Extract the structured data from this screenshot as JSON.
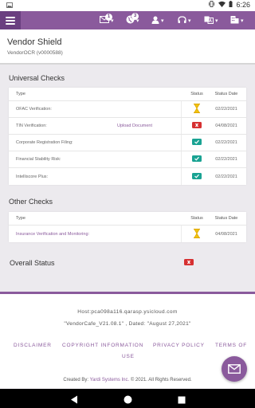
{
  "status_bar": {
    "time": "6:26"
  },
  "nav": {
    "messages_badge": "1",
    "notifications_badge": "3"
  },
  "header": {
    "title": "Vendor Shield",
    "subtitle": "VendorOCR (v0000588)"
  },
  "universal": {
    "title": "Universal Checks",
    "columns": {
      "type": "Type",
      "status": "Status",
      "date": "Status Date"
    },
    "rows": [
      {
        "type": "OFAC Verification:",
        "link": "",
        "status": "pending",
        "date": "02/22/2021"
      },
      {
        "type": "TIN Verification:",
        "link": "Upload Document",
        "status": "fail",
        "date": "04/08/2021"
      },
      {
        "type": "Corporate Registration Filing:",
        "link": "",
        "status": "ok",
        "date": "02/22/2021"
      },
      {
        "type": "Financial Stability Risk:",
        "link": "",
        "status": "ok",
        "date": "02/22/2021"
      },
      {
        "type": "Intelliscore Plus:",
        "link": "",
        "status": "ok",
        "date": "02/22/2021"
      }
    ]
  },
  "other": {
    "title": "Other Checks",
    "columns": {
      "type": "Type",
      "status": "Status",
      "date": "Status Date"
    },
    "rows": [
      {
        "type": "Insurance Verification and Monitoring:",
        "status": "pending",
        "date": "04/08/2021"
      }
    ]
  },
  "overall": {
    "label": "Overall Status",
    "status": "fail"
  },
  "footer": {
    "host": "Host:pca098a116.qarasp.ysicloud.com",
    "version": "\"VendorCafe_V21.08.1\" , Dated: \"August 27,2021\"",
    "links": {
      "disclaimer": "DISCLAIMER",
      "copyright_info": "COPYRIGHT INFORMATION",
      "privacy": "PRIVACY POLICY",
      "terms_line1": "TERMS OF",
      "terms_line2": "USE"
    },
    "copyright_prefix": "Created By:",
    "copyright_link": "Yardi Systems Inc.",
    "copyright_suffix": "© 2021. All Rights Reserved."
  },
  "colors": {
    "brand": "#8a5a9c",
    "brand_dark": "#6a3f80",
    "ok": "#1aa393",
    "fail": "#d63031",
    "pending": "#f1c40f"
  },
  "icons": {
    "status_bar": [
      "photo-icon",
      "vibrate-icon",
      "wifi-icon",
      "battery-icon"
    ],
    "nav": [
      "mail-icon",
      "globe-icon",
      "user-icon",
      "headset-icon",
      "translate-icon",
      "building-icon"
    ],
    "fab": "mail-icon"
  }
}
